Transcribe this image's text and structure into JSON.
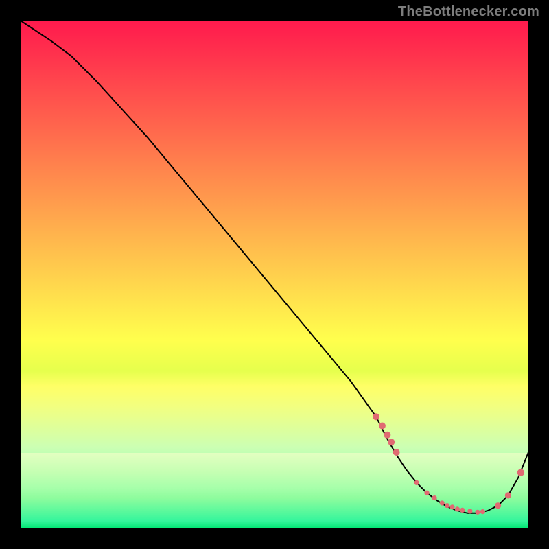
{
  "attribution": "TheBottlenecker.com",
  "chart_data": {
    "type": "line",
    "title": "",
    "xlabel": "",
    "ylabel": "",
    "xlim": [
      0,
      100
    ],
    "ylim": [
      0,
      100
    ],
    "series": [
      {
        "name": "bottleneck-curve",
        "x": [
          0,
          6,
          10,
          15,
          20,
          25,
          30,
          35,
          40,
          45,
          50,
          55,
          60,
          65,
          70,
          72,
          74,
          76,
          78,
          80,
          82,
          84,
          86,
          88,
          90,
          92,
          94,
          96,
          98,
          100
        ],
        "y": [
          100,
          96,
          93,
          88,
          82.5,
          77,
          71,
          65,
          59,
          53,
          47,
          41,
          35,
          29,
          22,
          18,
          14.5,
          11.5,
          9,
          7,
          5.5,
          4.3,
          3.5,
          3,
          3,
          3.5,
          4.5,
          6.5,
          10,
          15
        ]
      }
    ],
    "markers": {
      "name": "highlight-dots",
      "x": [
        70,
        71.2,
        72.2,
        73,
        74,
        78,
        80,
        81.5,
        83,
        84,
        85,
        86,
        87,
        88.5,
        90,
        91,
        94,
        96,
        98.5
      ],
      "y": [
        22,
        20.2,
        18.4,
        17,
        15,
        9,
        7,
        6,
        5,
        4.5,
        4.2,
        3.8,
        3.6,
        3.4,
        3.2,
        3.3,
        4.5,
        6.5,
        11
      ],
      "r": [
        5,
        5,
        5,
        5,
        5,
        3.6,
        3.6,
        3.6,
        3.6,
        3.6,
        3.6,
        3.6,
        3.6,
        3.6,
        3.6,
        3.6,
        4.6,
        4.6,
        5.2
      ]
    }
  }
}
